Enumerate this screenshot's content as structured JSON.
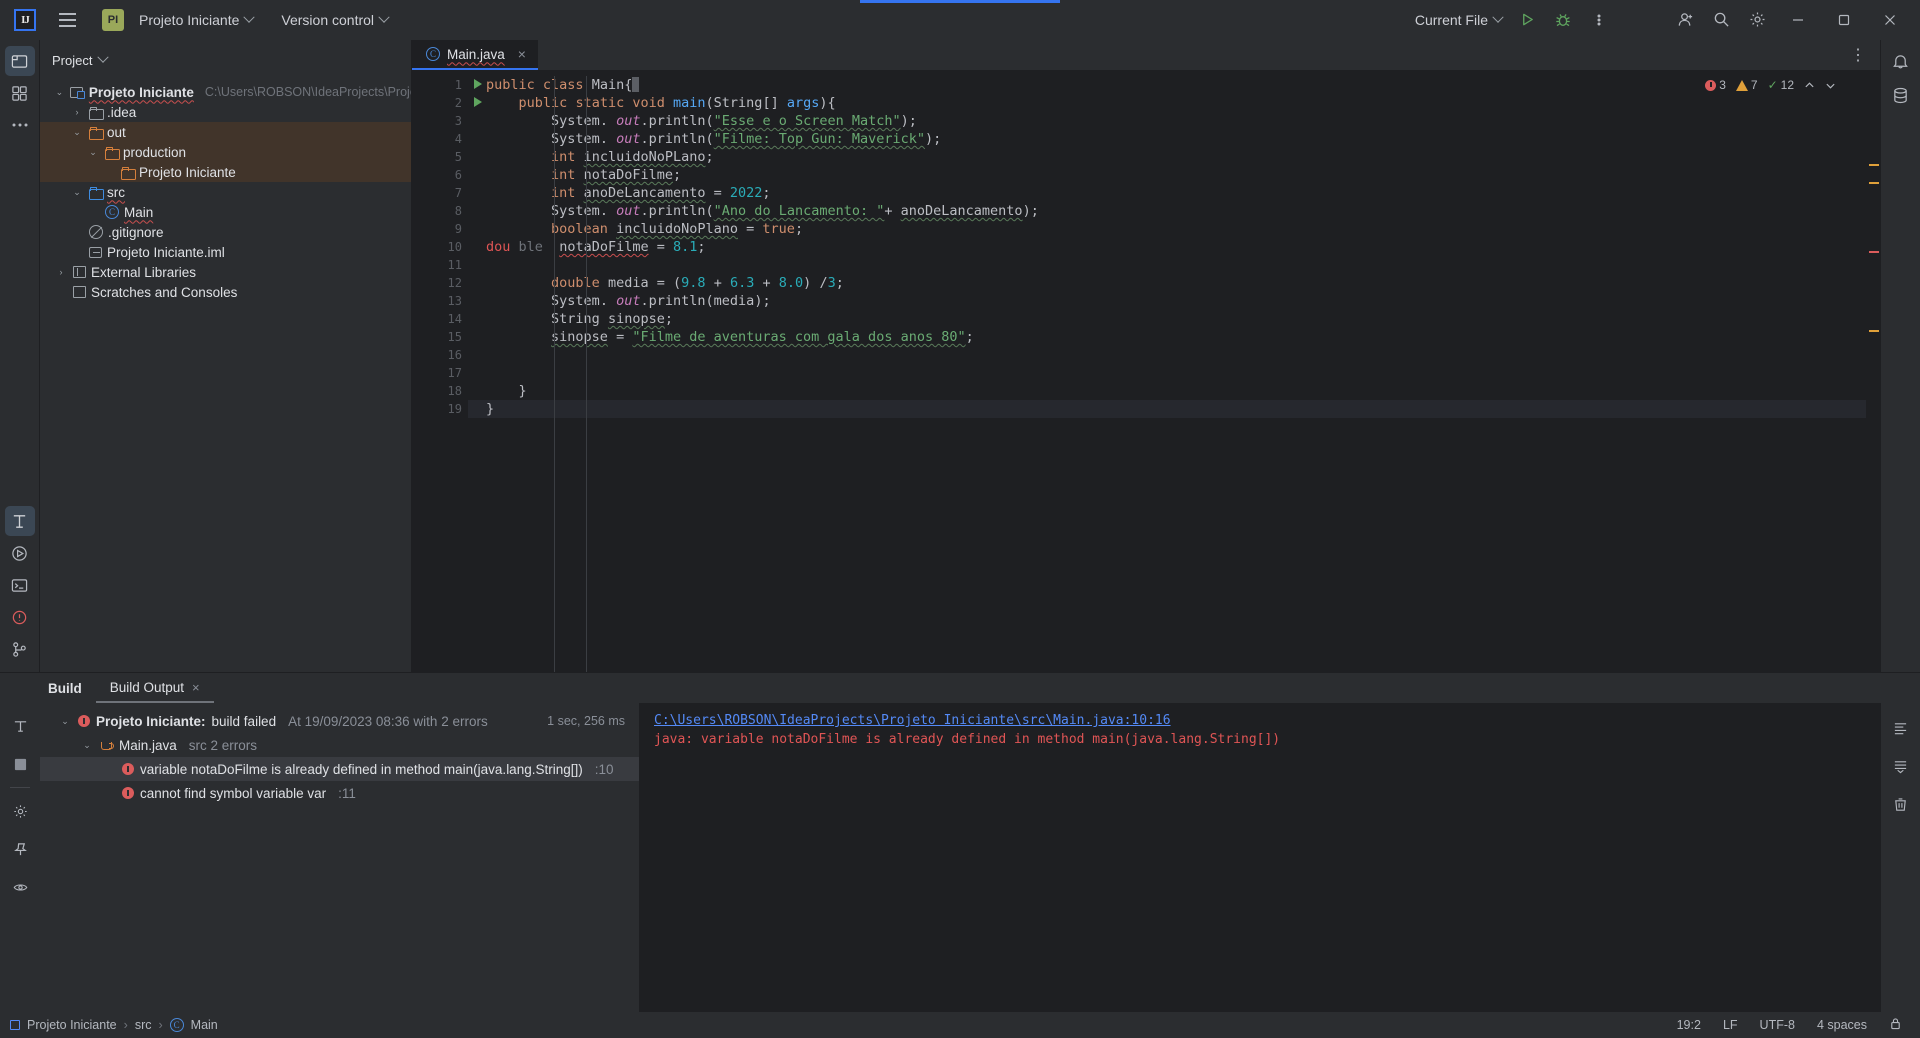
{
  "titlebar": {
    "logo": "IJ",
    "project_badge": "PI",
    "project_name": "Projeto Iniciante",
    "version_control": "Version control",
    "run_config": "Current File",
    "icons": [
      "menu-icon",
      "run-icon",
      "debug-icon",
      "more-actions-icon",
      "account-icon",
      "search-icon",
      "settings-icon"
    ],
    "window_controls": [
      "minimize",
      "maximize",
      "close"
    ]
  },
  "toolwindow": {
    "header": "Project",
    "tree": [
      {
        "label": "Projeto Iniciante",
        "path": "C:\\Users\\ROBSON\\IdeaProjects\\Projeto Iniciant",
        "icon": "module-icon",
        "arrow": "v",
        "indent": 0,
        "bold": true,
        "highlight": false
      },
      {
        "label": ".idea",
        "path": "",
        "icon": "folder-icon",
        "arrow": ">",
        "indent": 1,
        "bold": false,
        "highlight": false
      },
      {
        "label": "out",
        "path": "",
        "icon": "folder-orange-icon",
        "arrow": "v",
        "indent": 1,
        "bold": false,
        "highlight": true
      },
      {
        "label": "production",
        "path": "",
        "icon": "folder-orange-icon",
        "arrow": "v",
        "indent": 2,
        "bold": false,
        "highlight": true
      },
      {
        "label": "Projeto Iniciante",
        "path": "",
        "icon": "folder-orange-icon",
        "arrow": "",
        "indent": 3,
        "bold": false,
        "highlight": true
      },
      {
        "label": "src",
        "path": "",
        "icon": "folder-blue-icon",
        "arrow": "v",
        "indent": 1,
        "bold": false,
        "highlight": false
      },
      {
        "label": "Main",
        "path": "",
        "icon": "class-icon",
        "arrow": "",
        "indent": 2,
        "bold": false,
        "highlight": false
      },
      {
        "label": ".gitignore",
        "path": "",
        "icon": "gitignore-icon",
        "arrow": "",
        "indent": 1,
        "bold": false,
        "highlight": false
      },
      {
        "label": "Projeto Iniciante.iml",
        "path": "",
        "icon": "iml-icon",
        "arrow": "",
        "indent": 1,
        "bold": false,
        "highlight": false
      },
      {
        "label": "External Libraries",
        "path": "",
        "icon": "library-icon",
        "arrow": ">",
        "indent": 0,
        "bold": false,
        "highlight": false
      },
      {
        "label": "Scratches and Consoles",
        "path": "",
        "icon": "scratch-icon",
        "arrow": "",
        "indent": 0,
        "bold": false,
        "highlight": false
      }
    ]
  },
  "editor": {
    "tab": {
      "label": "Main.java",
      "icon": "java-class-icon",
      "close": "×"
    },
    "inspections": {
      "errors": "3",
      "warnings": "7",
      "weak": "12"
    },
    "lines": [
      {
        "n": "1",
        "run": true,
        "text": "public class Main{"
      },
      {
        "n": "2",
        "run": true,
        "text": "    public static void main(String[] args){"
      },
      {
        "n": "3",
        "run": false,
        "text": "        System. out.println(\"Esse e o Screen Match\");"
      },
      {
        "n": "4",
        "run": false,
        "text": "        System. out.println(\"Filme: Top Gun: Maverick\");"
      },
      {
        "n": "5",
        "run": false,
        "text": "        int incluidoNoPLano;"
      },
      {
        "n": "6",
        "run": false,
        "text": "        int notaDoFilme;"
      },
      {
        "n": "7",
        "run": false,
        "text": "        int anoDeLancamento = 2022;"
      },
      {
        "n": "8",
        "run": false,
        "text": "        System. out.println(\"Ano do Lancamento: \"+ anoDeLancamento);"
      },
      {
        "n": "9",
        "run": false,
        "text": "        boolean incluidoNoPlano = true;"
      },
      {
        "n": "10",
        "run": false,
        "text": "        dou ble  notaDoFilme = 8.1;"
      },
      {
        "n": "11",
        "run": false,
        "text": ""
      },
      {
        "n": "12",
        "run": false,
        "text": "        double media = (9.8 + 6.3 + 8.0) /3;"
      },
      {
        "n": "13",
        "run": false,
        "text": "        System. out.println(media);"
      },
      {
        "n": "14",
        "run": false,
        "text": "        String sinopse;"
      },
      {
        "n": "15",
        "run": false,
        "text": "        sinopse = \"Filme de aventuras com gala dos anos 80\";"
      },
      {
        "n": "16",
        "run": false,
        "text": ""
      },
      {
        "n": "17",
        "run": false,
        "text": ""
      },
      {
        "n": "18",
        "run": false,
        "text": "    }"
      },
      {
        "n": "19",
        "run": false,
        "text": "}"
      }
    ]
  },
  "build_panel": {
    "tab_title": "Build",
    "tab_output": "Build Output",
    "close": "×",
    "tree": [
      {
        "level": 0,
        "arrow": "v",
        "icon": "error-icon",
        "bold": "Projeto Iniciante:",
        "normal": " build failed",
        "grey": "At 19/09/2023 08:36 with 2 errors",
        "duration": "1 sec, 256 ms",
        "selected": false
      },
      {
        "level": 1,
        "arrow": "v",
        "icon": "java-icon",
        "bold": "",
        "normal": "Main.java",
        "grey": "src 2 errors",
        "duration": "",
        "selected": false
      },
      {
        "level": 2,
        "arrow": "",
        "icon": "error-icon",
        "bold": "",
        "normal": "variable notaDoFilme is already defined in method main(java.lang.String[])",
        "grey": ":10",
        "duration": "",
        "selected": true
      },
      {
        "level": 2,
        "arrow": "",
        "icon": "error-icon",
        "bold": "",
        "normal": "cannot find symbol variable var",
        "grey": ":11",
        "duration": "",
        "selected": false
      }
    ],
    "detail_link": "C:\\Users\\ROBSON\\IdeaProjects\\Projeto Iniciante\\src\\Main.java:10:16",
    "detail_error": "java: variable notaDoFilme is already defined in method main(java.lang.String[])"
  },
  "status_bar": {
    "breadcrumb": [
      "Projeto Iniciante",
      "src",
      "Main"
    ],
    "separator": "›",
    "caret": "19:2",
    "line_sep": "LF",
    "encoding": "UTF-8",
    "indent": "4 spaces",
    "lock_icon": "lock-icon"
  },
  "colors": {
    "accent": "#3574f0",
    "error": "#db5c5c",
    "warning": "#e0a03a",
    "ok": "#5fa55f",
    "bg_editor": "#1e1f22",
    "bg_chrome": "#2b2d30",
    "highlight_out": "#41342a"
  }
}
